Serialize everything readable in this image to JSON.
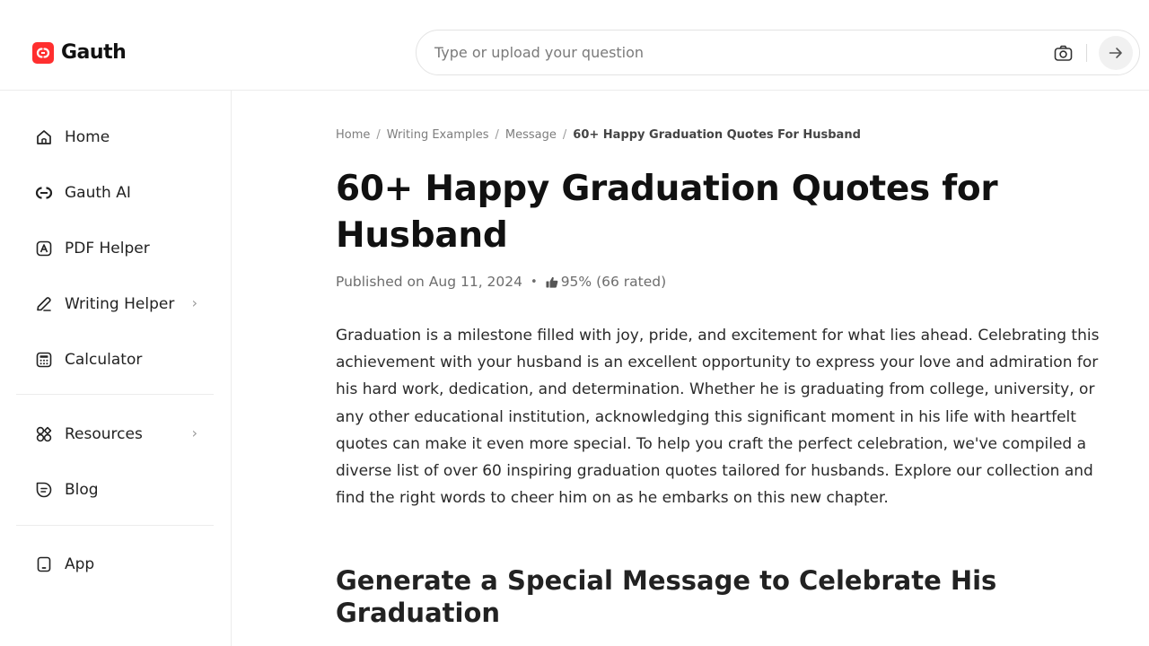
{
  "header": {
    "logo_text": "Gauth",
    "search": {
      "placeholder": "Type or upload your question",
      "value": ""
    },
    "icons": {
      "camera": "camera-icon",
      "submit": "arrow-right-icon"
    }
  },
  "sidebar": {
    "items": [
      {
        "label": "Home",
        "icon": "home-icon",
        "chevron": false
      },
      {
        "label": "Gauth AI",
        "icon": "gauth-ai-icon",
        "chevron": false
      },
      {
        "label": "PDF Helper",
        "icon": "pdf-icon",
        "chevron": false
      },
      {
        "label": "Writing Helper",
        "icon": "pen-icon",
        "chevron": true
      },
      {
        "label": "Calculator",
        "icon": "calculator-icon",
        "chevron": false
      },
      {
        "label": "Resources",
        "icon": "resources-icon",
        "chevron": true
      },
      {
        "label": "Blog",
        "icon": "blog-icon",
        "chevron": false
      },
      {
        "label": "App",
        "icon": "phone-icon",
        "chevron": false
      }
    ],
    "chevron_glyph": "›"
  },
  "breadcrumb": {
    "items": [
      "Home",
      "Writing Examples",
      "Message"
    ],
    "current": "60+ Happy Graduation Quotes For Husband",
    "separator": "/"
  },
  "article": {
    "title": "60+ Happy Graduation Quotes for Husband",
    "published": "Published on Aug 11, 2024",
    "bullet": "•",
    "rating": "95% (66 rated)",
    "intro": "Graduation is a milestone filled with joy, pride, and excitement for what lies ahead. Celebrating this achievement with your husband is an excellent opportunity to express your love and admiration for his hard work, dedication, and determination. Whether he is graduating from college, university, or any other educational institution, acknowledging this significant moment in his life with heartfelt quotes can make it even more special. To help you craft the perfect celebration, we've compiled a diverse list of over 60 inspiring graduation quotes tailored for husbands. Explore our collection and find the right words to cheer him on as he embarks on this new chapter.",
    "section_heading": "Generate a Special Message to Celebrate His Graduation"
  },
  "colors": {
    "brand": "#ff2f2f",
    "text": "#1f1f1f",
    "muted": "#6d6d6d",
    "border": "#ececec"
  }
}
